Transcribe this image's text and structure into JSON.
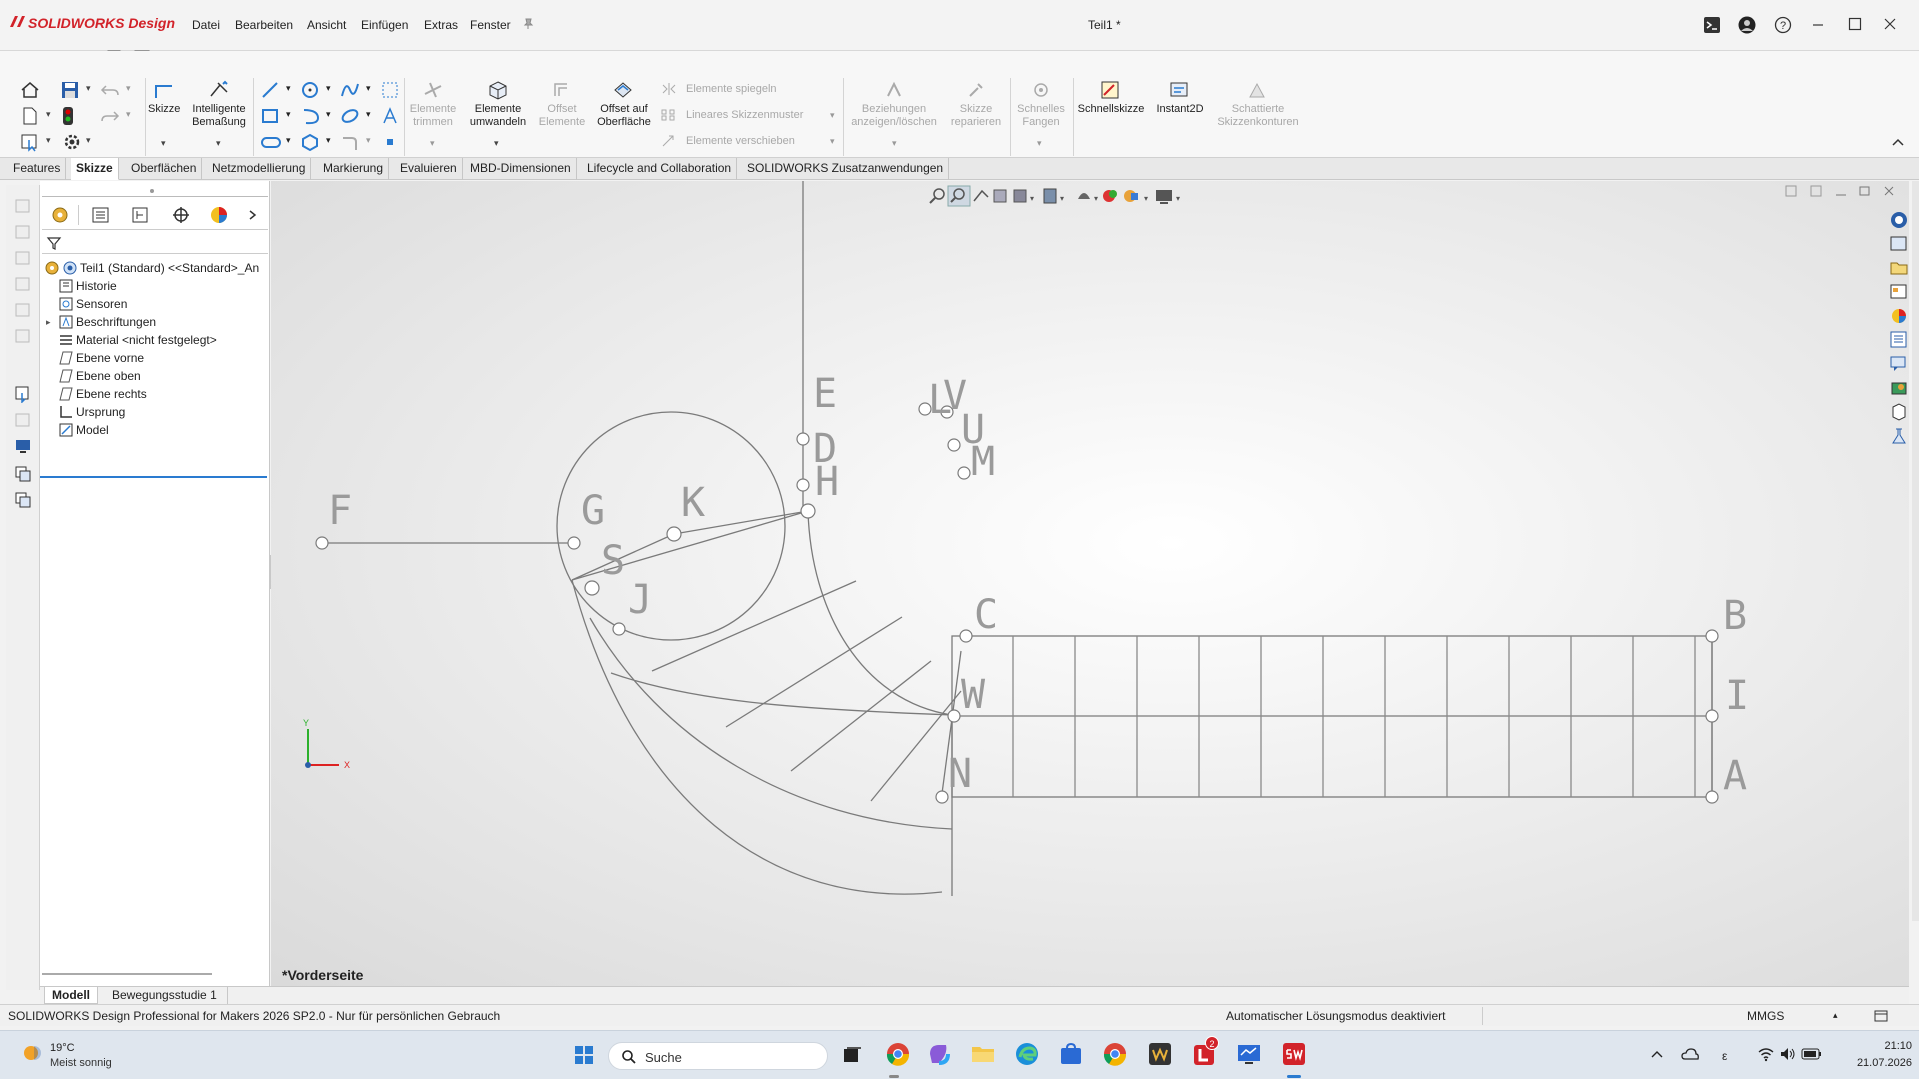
{
  "app": {
    "logo": "SOLIDWORKS Design",
    "menus": [
      "Datei",
      "Bearbeiten",
      "Ansicht",
      "Einfügen",
      "Extras",
      "Fenster"
    ],
    "doc_title": "Teil1 *"
  },
  "ribbon": {
    "skizze": "Skizze",
    "bemassung_1": "Intelligente",
    "bemassung_2": "Bemaßung",
    "trimmen_1": "Elemente",
    "trimmen_2": "trimmen",
    "umwandeln_1": "Elemente",
    "umwandeln_2": "umwandeln",
    "offset_1": "Offset",
    "offset_2": "Elemente",
    "offset_oberflaeche_1": "Offset auf",
    "offset_oberflaeche_2": "Oberfläche",
    "spiegeln": "Elemente spiegeln",
    "muster": "Lineares Skizzenmuster",
    "verschieben": "Elemente verschieben",
    "beziehungen_1": "Beziehungen",
    "beziehungen_2": "anzeigen/löschen",
    "reparieren_1": "Skizze",
    "reparieren_2": "reparieren",
    "fangen_1": "Schnelles",
    "fangen_2": "Fangen",
    "schnellskizze": "Schnellskizze",
    "instant2d": "Instant2D",
    "konturen_1": "Schattierte",
    "konturen_2": "Skizzenkonturen"
  },
  "tabs": [
    "Features",
    "Skizze",
    "Oberflächen",
    "Netzmodellierung",
    "Markierung",
    "Evaluieren",
    "MBD-Dimensionen",
    "Lifecycle and Collaboration",
    "SOLIDWORKS Zusatzanwendungen"
  ],
  "active_tab": "Skizze",
  "tree": {
    "root": "Teil1 (Standard) <<Standard>_An",
    "items": [
      "Historie",
      "Sensoren",
      "Beschriftungen",
      "Material <nicht festgelegt>",
      "Ebene vorne",
      "Ebene oben",
      "Ebene rechts",
      "Ursprung",
      "Model"
    ]
  },
  "viewport": {
    "view_label": "*Vorderseite",
    "triad_x": "X",
    "triad_y": "Y",
    "sketch_points": [
      "E",
      "D",
      "H",
      "F",
      "G",
      "K",
      "S",
      "J",
      "C",
      "W",
      "N",
      "B",
      "I",
      "A",
      "L",
      "V",
      "U",
      "M"
    ]
  },
  "bottom_tabs": [
    "Modell",
    "Bewegungsstudie 1"
  ],
  "status": {
    "left": "SOLIDWORKS Design Professional for Makers 2026 SP2.0 - Nur für persönlichen Gebrauch",
    "center": "Automatischer Lösungsmodus deaktiviert",
    "units": "MMGS"
  },
  "taskbar": {
    "temperature": "19°C",
    "weather": "Meist sonnig",
    "search": "Suche",
    "time": "21:10",
    "date": "21.07.2026",
    "badge": "2"
  },
  "colors": {
    "brand_red": "#d2232a",
    "sketch_gray": "#7a7a7a",
    "selection_blue": "#2a7bd0"
  }
}
